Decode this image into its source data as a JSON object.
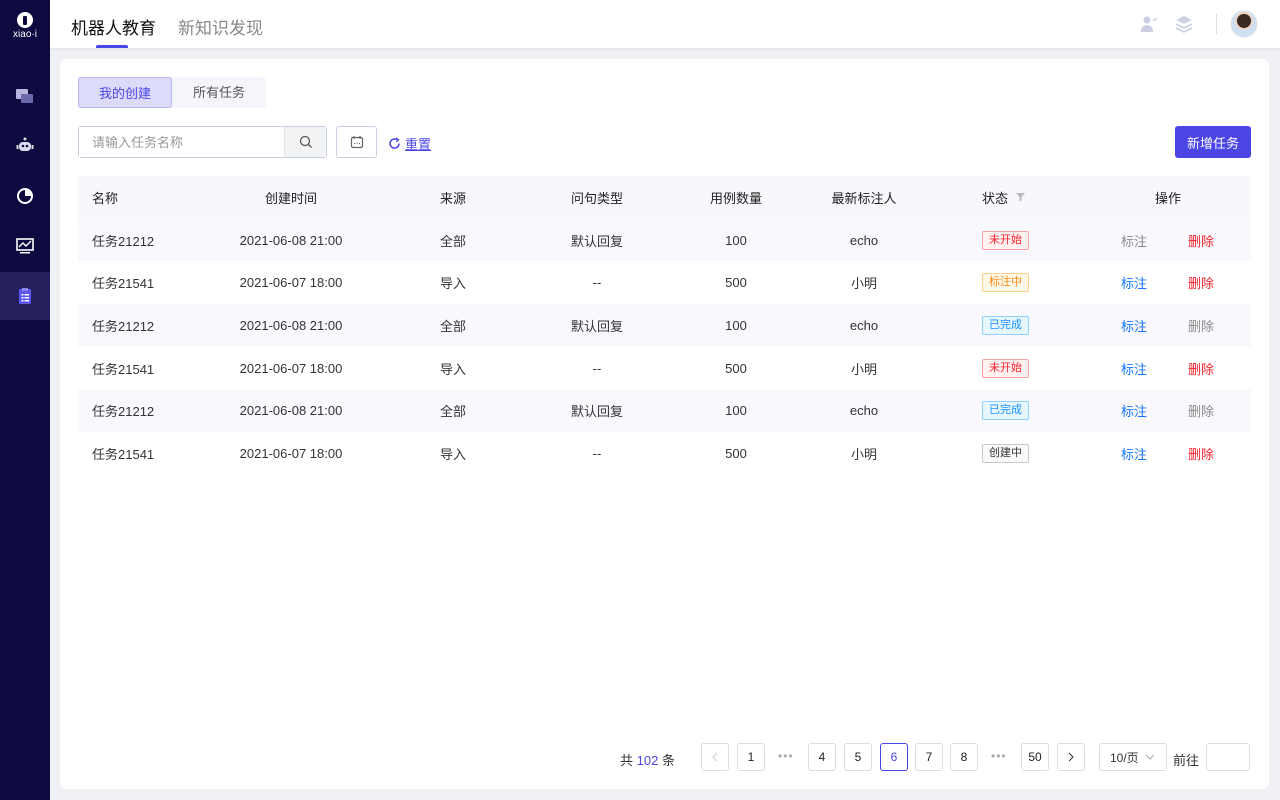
{
  "logo": {
    "text": "xiao·i"
  },
  "sidebar": {
    "items": [
      {
        "icon": "qa-chat-icon"
      },
      {
        "icon": "robot-icon"
      },
      {
        "icon": "pie-chart-icon"
      },
      {
        "icon": "monitor-chart-icon"
      },
      {
        "icon": "clipboard-list-icon",
        "active": true
      }
    ]
  },
  "header": {
    "tabs": [
      {
        "label": "机器人教育",
        "active": true
      },
      {
        "label": "新知识发现"
      }
    ]
  },
  "segments": [
    {
      "label": "我的创建",
      "active": true
    },
    {
      "label": "所有任务"
    }
  ],
  "search": {
    "placeholder": "请输入任务名称",
    "value": ""
  },
  "reset_label": "重置",
  "add_label": "新增任务",
  "table": {
    "headers": [
      "名称",
      "创建时间",
      "来源",
      "问句类型",
      "用例数量",
      "最新标注人",
      "状态",
      "操作"
    ],
    "rows": [
      {
        "name": "任务21212",
        "time": "2021-06-08 21:00",
        "source": "全部",
        "type": "默认回复",
        "count": "100",
        "annotator": "echo",
        "status": "未开始",
        "status_color": "red",
        "mark": "标注",
        "mark_enabled": false,
        "del": "删除",
        "del_enabled": true
      },
      {
        "name": "任务21541",
        "time": "2021-06-07 18:00",
        "source": "导入",
        "type": "--",
        "count": "500",
        "annotator": "小明",
        "status": "标注中",
        "status_color": "orange",
        "mark": "标注",
        "mark_enabled": true,
        "del": "删除",
        "del_enabled": true
      },
      {
        "name": "任务21212",
        "time": "2021-06-08 21:00",
        "source": "全部",
        "type": "默认回复",
        "count": "100",
        "annotator": "echo",
        "status": "已完成",
        "status_color": "blue",
        "mark": "标注",
        "mark_enabled": true,
        "del": "删除",
        "del_enabled": false
      },
      {
        "name": "任务21541",
        "time": "2021-06-07 18:00",
        "source": "导入",
        "type": "--",
        "count": "500",
        "annotator": "小明",
        "status": "未开始",
        "status_color": "red",
        "mark": "标注",
        "mark_enabled": true,
        "del": "删除",
        "del_enabled": true
      },
      {
        "name": "任务21212",
        "time": "2021-06-08 21:00",
        "source": "全部",
        "type": "默认回复",
        "count": "100",
        "annotator": "echo",
        "status": "已完成",
        "status_color": "blue",
        "mark": "标注",
        "mark_enabled": true,
        "del": "删除",
        "del_enabled": false
      },
      {
        "name": "任务21541",
        "time": "2021-06-07 18:00",
        "source": "导入",
        "type": "--",
        "count": "500",
        "annotator": "小明",
        "status": "创建中",
        "status_color": "gray",
        "mark": "标注",
        "mark_enabled": true,
        "del": "删除",
        "del_enabled": true
      }
    ]
  },
  "pagination": {
    "total_prefix": "共",
    "total": "102",
    "total_suffix": "条",
    "pages": [
      "1",
      "4",
      "5",
      "6",
      "7",
      "8",
      "50"
    ],
    "current": "6",
    "page_size": "10/页",
    "goto_label": "前往",
    "goto_value": ""
  },
  "colors": {
    "accent": "#4b45e6",
    "sidebar": "#0c0a3e",
    "link": "#1677ff",
    "danger": "#f5222d",
    "disabled": "#8c8c8c"
  }
}
